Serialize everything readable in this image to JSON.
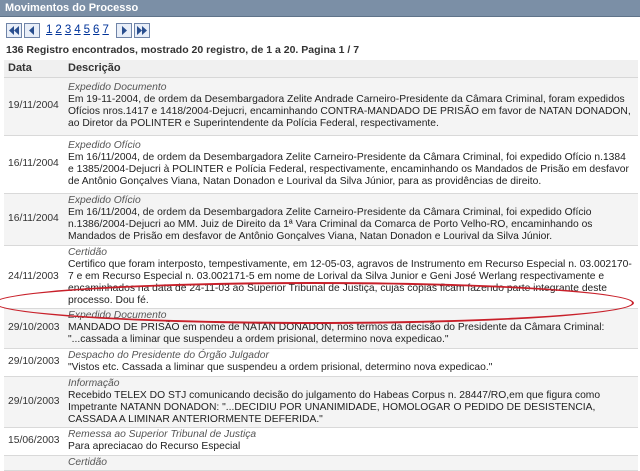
{
  "panel": {
    "title": "Movimentos do Processo"
  },
  "pager": {
    "pages": [
      "1",
      "2",
      "3",
      "4",
      "5",
      "6",
      "7"
    ],
    "current": "1"
  },
  "summary": "136 Registro encontrados, mostrado 20 registro, de 1 a 20. Pagina 1 / 7",
  "table": {
    "headers": {
      "date": "Data",
      "desc": "Descrição"
    },
    "rows": [
      {
        "date": "19/11/2004",
        "type": "Expedido Documento",
        "text": "Em 19-11-2004, de ordem da Desembargadora Zelite Andrade Carneiro-Presidente da Câmara Criminal, foram expedidos Ofícios nros.1417 e 1418/2004-Dejucri, encaminhando CONTRA-MANDADO DE PRISÃO em favor de NATAN DONADON, ao Diretor da POLINTER e Superintendente da Polícia Federal, respectivamente."
      },
      {
        "date": "16/11/2004",
        "type": "Expedido Ofício",
        "text": "Em 16/11/2004, de ordem da Desembargadora Zelite Carneiro-Presidente da Câmara Criminal, foi expedido Ofício n.1384 e 1385/2004-Dejucri à POLINTER e Polícia Federal, respectivamente, encaminhando os Mandados de Prisão em desfavor de Antônio Gonçalves Viana, Natan Donadon e Lourival da Silva Júnior, para as providências de direito."
      },
      {
        "date": "16/11/2004",
        "type": "Expedido Ofício",
        "text": "Em 16/11/2004, de ordem da Desembargadora Zelite Carneiro-Presidente da Câmara Criminal, foi expedido Ofício n.1386/2004-Dejucri ao MM. Juiz de Direito da 1ª Vara Criminal da Comarca de Porto Velho-RO, encaminhando os Mandados de Prisão em desfavor de Antônio Gonçalves Viana, Natan Donadon e Lourival da Silva Júnior."
      },
      {
        "date": "24/11/2003",
        "type": "Certidão",
        "text": "Certifico que foram interposto, tempestivamente, em 12-05-03, agravos de Instrumento em Recurso Especial n. 03.002170-7 e em Recurso Especial n. 03.002171-5 em nome de Lorival da Silva Junior e Geni José Werlang respectivamente e encaminhados na data de 24-11-03 ao Superior Tribunal de Justiça, cujas cópias ficam fazendo parte integrante deste processo. Dou fé."
      },
      {
        "date": "29/10/2003",
        "type": "Expedido Documento",
        "text": "MANDADO DE PRISÃO em nome de NATAN DONADON, nos termos da decisão do Presidente da Câmara Criminal: \"...cassada a liminar que suspendeu a ordem prisional, determino nova expedicao.\""
      },
      {
        "date": "29/10/2003",
        "type": "Despacho do Presidente do Órgão Julgador",
        "text": "\"Vistos etc. Cassada a liminar que suspendeu a ordem prisional, determino nova expedicao.\""
      },
      {
        "date": "29/10/2003",
        "type": "Informação",
        "text": "Recebido TELEX DO STJ comunicando decisão do julgamento do Habeas Corpus n. 28447/RO,em que figura como Impetrante NATANN DONADON: \"...DECIDIU POR UNANIMIDADE, HOMOLOGAR O PEDIDO DE DESISTENCIA, CASSADA A LIMINAR ANTERIORMENTE DEFERIDA.\""
      },
      {
        "date": "15/06/2003",
        "type": "Remessa ao Superior Tribunal de Justiça",
        "text": "Para apreciacao do Recurso Especial"
      },
      {
        "date": "",
        "type": "Certidão",
        "text": ""
      }
    ]
  }
}
